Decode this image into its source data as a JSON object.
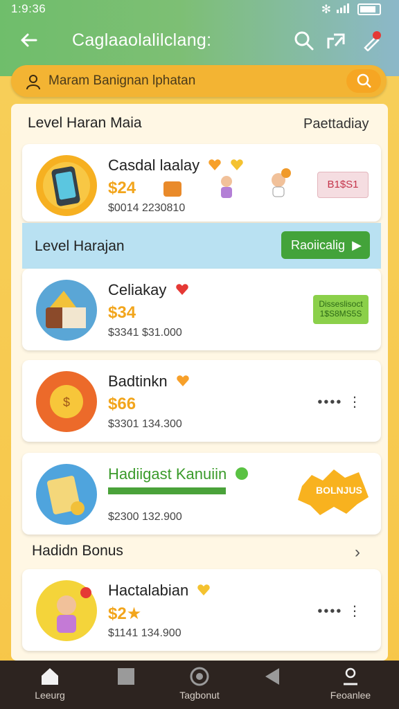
{
  "status": {
    "time": "1:9:36"
  },
  "header": {
    "title": "Caglaaolalilclang:"
  },
  "search": {
    "placeholder": "Maram Banignan lphatan"
  },
  "section1": {
    "title": "Level Haran Maia",
    "right": "Paettadiay"
  },
  "cards": [
    {
      "name": "Casdal laalay",
      "price": "$24",
      "meta": "$0014   2230810",
      "tag": "B1$S1"
    },
    {
      "name": "Celiakay",
      "price": "$34",
      "meta": "$3341 $31.000",
      "tag": "Disseslisoct 1$S8MS5S"
    },
    {
      "name": "Badtinkn",
      "price": "$66",
      "meta": "$3301  134.300"
    },
    {
      "name": "Hadiigast Kanuiin",
      "meta": "$2300  132.900",
      "badge": "BOLNJUS"
    },
    {
      "name": "Hactalabian",
      "price": "$2★",
      "meta": "$1141  134.900"
    }
  ],
  "band": {
    "title": "Level Harajan",
    "button": "Raoiicalig"
  },
  "section2": {
    "title": "Hadidn Bonus"
  },
  "nav": [
    {
      "label": "Leeurg"
    },
    {
      "label": ""
    },
    {
      "label": "Tagbonut"
    },
    {
      "label": ""
    },
    {
      "label": "Feoanlee"
    }
  ],
  "colors": {
    "accent": "#f6a623",
    "green": "#43a33a",
    "price": "#f2a51c",
    "heart_red": "#e53935",
    "heart_orange": "#f7a02a"
  }
}
